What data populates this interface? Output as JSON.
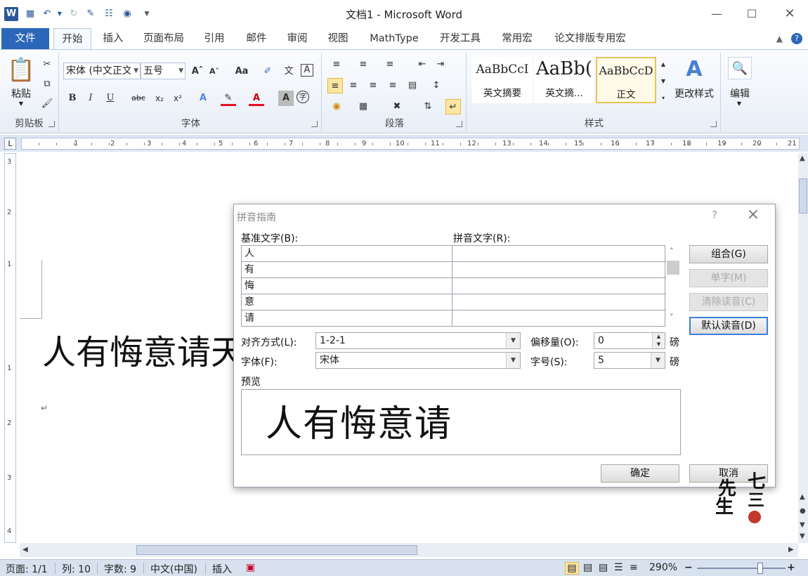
{
  "app": {
    "title": "文档1 - Microsoft Word",
    "logo": "W"
  },
  "tabs": {
    "file": "文件",
    "items": [
      "开始",
      "插入",
      "页面布局",
      "引用",
      "邮件",
      "审阅",
      "视图",
      "MathType",
      "开发工具",
      "常用宏",
      "论文排版专用宏"
    ]
  },
  "ribbon": {
    "clipboard": {
      "label": "剪贴板",
      "paste": "粘贴"
    },
    "font": {
      "label": "字体",
      "name": "宋体 (中文正文)",
      "size": "五号",
      "change_case": "Aa",
      "phonetic": "文",
      "char_border": "A"
    },
    "paragraph": {
      "label": "段落"
    },
    "styles": {
      "label": "样式",
      "items": [
        {
          "sample": "AaBbCcI",
          "name": "英文摘要"
        },
        {
          "sample": "AaBb(",
          "name": "英文摘..."
        },
        {
          "sample": "AaBbCcD",
          "name": "正文"
        }
      ],
      "change": "更改样式"
    },
    "editing": {
      "label": "编辑"
    }
  },
  "document": {
    "text": "人有悔意请天",
    "para_mark": "↵"
  },
  "ruler": {
    "h_numbers": [
      "1",
      "2",
      "3",
      "4",
      "5",
      "6",
      "7",
      "8",
      "9",
      "10",
      "11",
      "12",
      "13",
      "14",
      "15",
      "16",
      "17",
      "18",
      "19",
      "20",
      "21"
    ],
    "v_numbers": [
      "3",
      "2",
      "1",
      "1",
      "2",
      "3",
      "4"
    ]
  },
  "status": {
    "page": "页面: 1/1",
    "col": "列: 10",
    "words": "字数: 9",
    "lang": "中文(中国)",
    "mode": "插入",
    "zoom": "290%",
    "zoom_minus": "−",
    "zoom_plus": "+"
  },
  "dialog": {
    "title": "拼音指南",
    "help": "?",
    "base_label": "基准文字(B):",
    "ruby_label": "拼音文字(R):",
    "rows": [
      {
        "base": "人",
        "ruby": ""
      },
      {
        "base": "有",
        "ruby": ""
      },
      {
        "base": "悔",
        "ruby": ""
      },
      {
        "base": "意",
        "ruby": ""
      },
      {
        "base": "请",
        "ruby": ""
      }
    ],
    "buttons": {
      "group": "组合(G)",
      "mono": "单字(M)",
      "clear": "清除读音(C)",
      "default": "默认读音(D)",
      "ok": "确定",
      "cancel": "取消"
    },
    "align_label": "对齐方式(L):",
    "align_value": "1-2-1",
    "offset_label": "偏移量(O):",
    "offset_value": "0",
    "offset_unit": "磅",
    "font_label": "字体(F):",
    "font_value": "宋体",
    "size_label": "字号(S):",
    "size_value": "5",
    "size_unit": "磅",
    "preview_label": "预览",
    "preview_text": "人有悔意请"
  },
  "watermark": {
    "text": "七三先生"
  },
  "colors": {
    "accent": "#2b579a",
    "file_tab": "#2b67b8",
    "ribbon_bg": "#e8eef7"
  }
}
